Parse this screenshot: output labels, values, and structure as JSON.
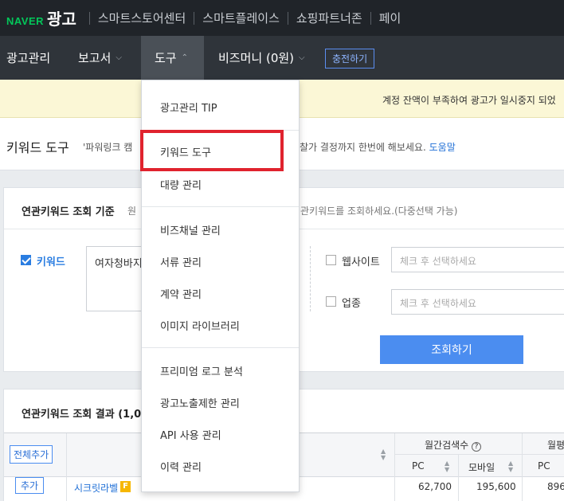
{
  "topbar": {
    "brand_naver": "NAVER",
    "brand_ad": "광고",
    "links": [
      "스마트스토어센터",
      "스마트플레이스",
      "쇼핑파트너존",
      "페이"
    ]
  },
  "nav": {
    "items": [
      {
        "label": "광고관리",
        "chevron": ""
      },
      {
        "label": "보고서",
        "chevron": "⌵"
      },
      {
        "label": "도구",
        "chevron": "⌃"
      },
      {
        "label": "비즈머니 (0원)",
        "chevron": "⌵"
      }
    ],
    "charge_label": "충전하기"
  },
  "notice": {
    "text": "계정 잔액이 부족하여 광고가 일시중지 되었"
  },
  "page": {
    "title": "키워드 도구",
    "desc": "'파워링크 캠",
    "desc_tail": "찰가 결정까지 한번에 해보세요.",
    "help": "도움말"
  },
  "criteria": {
    "header": "연관키워드 조회 기준",
    "header_desc": "원",
    "header_desc_tail": "관키워드를 조회하세요.(다중선택 가능)",
    "keyword_label": "키워드",
    "keyword_value": "여자청바지",
    "website_label": "웹사이트",
    "website_placeholder": "체크 후 선택하세요",
    "industry_label": "업종",
    "industry_placeholder": "체크 후 선택하세요",
    "search_button": "조회하기"
  },
  "results": {
    "header": "연관키워드 조회 결과 (1,0",
    "add_all": "전체추가",
    "col_monthly": "월간검색수",
    "col_monthly_icon": "?",
    "col_avg": "월평",
    "sub_pc": "PC",
    "sub_mobile": "모바일",
    "sub_pc2": "PC",
    "row": {
      "add": "추가",
      "keyword": "시크릿라벨",
      "badge": "F",
      "pc": "62,700",
      "mobile": "195,600",
      "avg_pc": "896"
    }
  },
  "dropdown": {
    "groups": [
      [
        "광고관리 TIP"
      ],
      [
        "키워드 도구",
        "대량 관리"
      ],
      [
        "비즈채널 관리",
        "서류 관리",
        "계약 관리",
        "이미지 라이브러리"
      ],
      [
        "프리미엄 로그 분석",
        "광고노출제한 관리",
        "API 사용 관리",
        "이력 관리"
      ]
    ]
  },
  "colors": {
    "accent": "#4b8df0",
    "highlight": "#e0232e",
    "brand_green": "#03c75a"
  }
}
